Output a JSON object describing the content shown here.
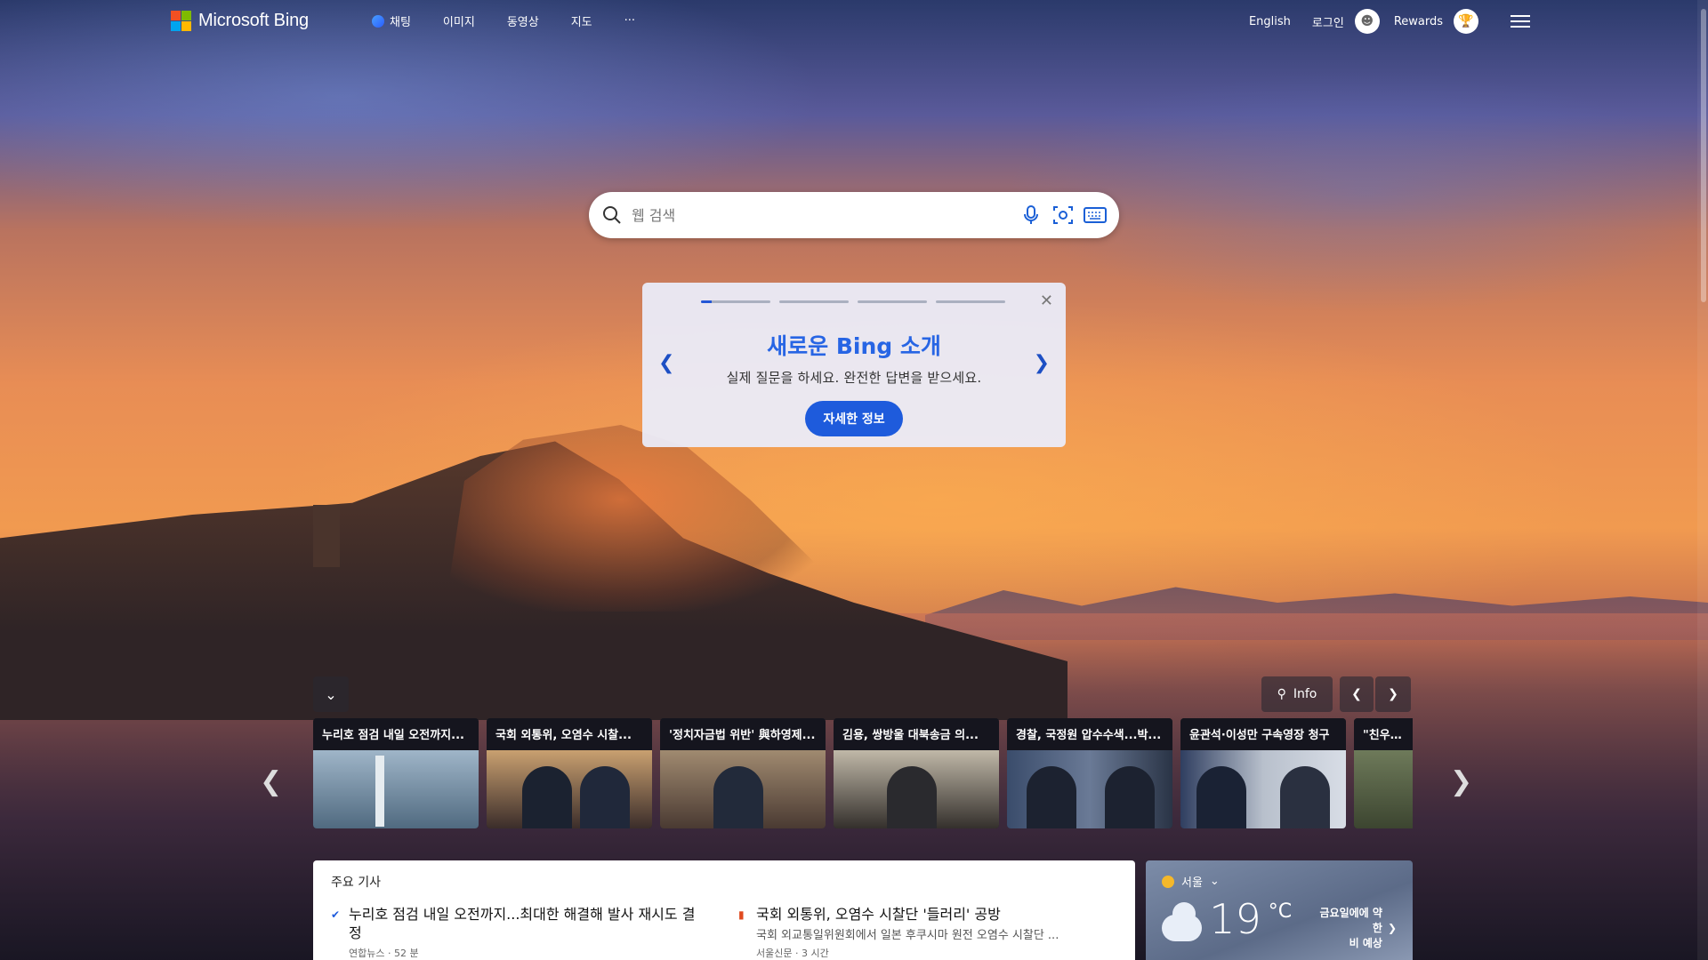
{
  "header": {
    "logo_text": "Microsoft Bing",
    "logo_colors": [
      "#f25022",
      "#7fba00",
      "#00a4ef",
      "#ffb900"
    ],
    "nav": [
      {
        "label": "채팅",
        "icon": "chat-icon"
      },
      {
        "label": "이미지"
      },
      {
        "label": "동영상"
      },
      {
        "label": "지도"
      },
      {
        "label": "···"
      }
    ],
    "language": "English",
    "login": "로그인",
    "rewards": "Rewards"
  },
  "search": {
    "placeholder": "웹 검색",
    "icons": [
      "search-icon",
      "microphone-icon",
      "visual-search-icon",
      "keyboard-icon"
    ]
  },
  "promo": {
    "title": "새로운 Bing 소개",
    "subtitle": "실제 질문을 하세요. 완전한 답변을 받으세요.",
    "button": "자세한 정보",
    "slides": 4,
    "active_slide": 1
  },
  "carousel_controls": {
    "info": "Info"
  },
  "carousel": [
    {
      "title": "누리호 점검 내일 오전까지..."
    },
    {
      "title": "국회 외통위, 오염수 시찰..."
    },
    {
      "title": "'정치자금법 위반' 與하영제..."
    },
    {
      "title": "김용, 쌍방울 대북송금 의..."
    },
    {
      "title": "경찰, 국정원 압수수색...박..."
    },
    {
      "title": "윤관석·이성만 구속영장 청구"
    },
    {
      "title": "\"친우크라"
    }
  ],
  "news": {
    "header": "주요 기사",
    "items": [
      {
        "title": "누리호 점검 내일 오전까지...최대한 해결해 발사 재시도 결정",
        "desc": "",
        "meta": "연합뉴스 · 52 분"
      },
      {
        "title": "국회 외통위, 오염수 시찰단 '들러리' 공방",
        "desc": "국회 외교통일위원회에서 일본 후쿠시마 원전 오염수 시찰단 ...",
        "meta": "서울신문 · 3 시간"
      }
    ]
  },
  "weather": {
    "city": "서울",
    "temp": "19",
    "unit": "°C",
    "forecast_line1": "금요일에에 약한",
    "forecast_line2": "비 예상"
  }
}
